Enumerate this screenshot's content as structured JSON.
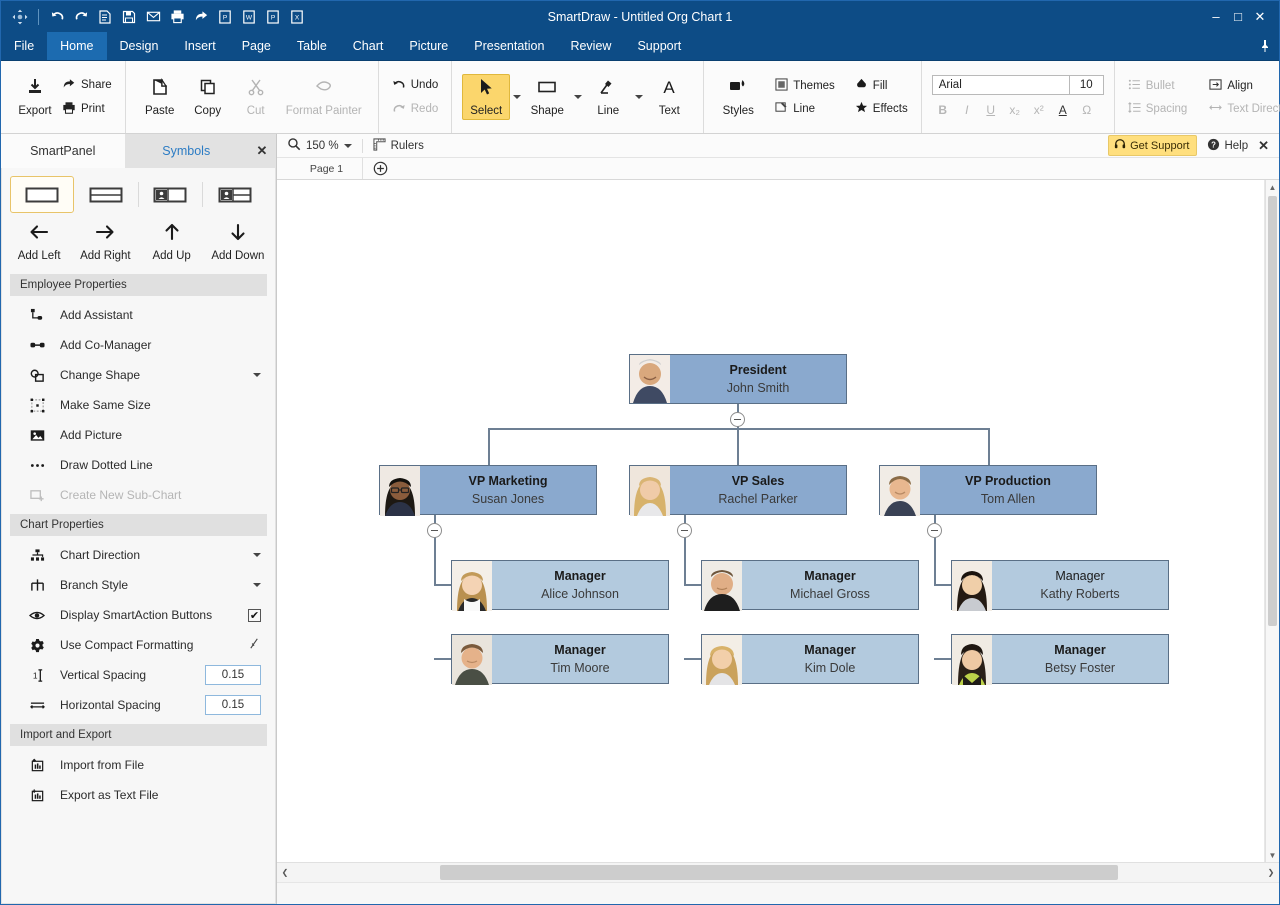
{
  "window": {
    "title": "SmartDraw - Untitled Org Chart 1",
    "minimize": "–",
    "maximize": "□",
    "close": "✕"
  },
  "quick_access": [
    {
      "name": "smartdraw-logo-icon",
      "label": "SmartDraw"
    },
    {
      "name": "undo-icon",
      "label": "Undo"
    },
    {
      "name": "redo-icon",
      "label": "Redo"
    },
    {
      "name": "new-document-icon",
      "label": "New"
    },
    {
      "name": "save-icon",
      "label": "Save"
    },
    {
      "name": "email-icon",
      "label": "Email"
    },
    {
      "name": "print-icon",
      "label": "Print"
    },
    {
      "name": "share-icon",
      "label": "Share"
    },
    {
      "name": "export-pdf-icon",
      "label": "PDF"
    },
    {
      "name": "export-word-icon",
      "label": "Word"
    },
    {
      "name": "export-powerpoint-icon",
      "label": "PowerPoint"
    },
    {
      "name": "export-excel-icon",
      "label": "Excel"
    }
  ],
  "menu": {
    "items": [
      {
        "label": "File",
        "active": false
      },
      {
        "label": "Home",
        "active": true
      },
      {
        "label": "Design",
        "active": false
      },
      {
        "label": "Insert",
        "active": false
      },
      {
        "label": "Page",
        "active": false
      },
      {
        "label": "Table",
        "active": false
      },
      {
        "label": "Chart",
        "active": false
      },
      {
        "label": "Picture",
        "active": false
      },
      {
        "label": "Presentation",
        "active": false
      },
      {
        "label": "Review",
        "active": false
      },
      {
        "label": "Support",
        "active": false
      }
    ],
    "pin_icon": "pin-icon"
  },
  "ribbon": {
    "export": "Export",
    "share": "Share",
    "print": "Print",
    "paste": "Paste",
    "copy": "Copy",
    "cut": "Cut",
    "format_painter": "Format Painter",
    "undo": "Undo",
    "redo": "Redo",
    "select": "Select",
    "shape": "Shape",
    "line": "Line",
    "text": "Text",
    "styles": "Styles",
    "themes": "Themes",
    "line_style": "Line",
    "fill": "Fill",
    "effects": "Effects",
    "font_name": "Arial",
    "font_size": "10",
    "bold": "B",
    "italic": "I",
    "underline": "U",
    "subscript": "x₂",
    "superscript": "x²",
    "font_color": "A",
    "symbol": "Ω",
    "bullet": "Bullet",
    "spacing": "Spacing",
    "align": "Align",
    "text_direction": "Text Direction"
  },
  "sidebar": {
    "tabs": [
      {
        "label": "SmartPanel",
        "active": true
      },
      {
        "label": "Symbols",
        "active": false
      }
    ],
    "close": "✕",
    "templates": [
      {
        "name": "shape-single-line-template",
        "active": true
      },
      {
        "name": "shape-two-line-template",
        "active": false
      },
      {
        "name": "shape-photo-left-template",
        "active": false
      },
      {
        "name": "shape-photo-detail-template",
        "active": false
      }
    ],
    "add_buttons": [
      {
        "label": "Add Left",
        "icon": "arrow-left-icon"
      },
      {
        "label": "Add Right",
        "icon": "arrow-right-icon"
      },
      {
        "label": "Add Up",
        "icon": "arrow-up-icon"
      },
      {
        "label": "Add Down",
        "icon": "arrow-down-icon"
      }
    ],
    "employee_section": "Employee Properties",
    "employee_items": [
      {
        "label": "Add Assistant",
        "icon": "add-assistant-icon",
        "disabled": false,
        "control": "none"
      },
      {
        "label": "Add Co-Manager",
        "icon": "add-comanager-icon",
        "disabled": false,
        "control": "none"
      },
      {
        "label": "Change Shape",
        "icon": "change-shape-icon",
        "disabled": false,
        "control": "caret"
      },
      {
        "label": "Make Same Size",
        "icon": "make-same-size-icon",
        "disabled": false,
        "control": "none"
      },
      {
        "label": "Add Picture",
        "icon": "add-picture-icon",
        "disabled": false,
        "control": "none"
      },
      {
        "label": "Draw Dotted Line",
        "icon": "dotted-line-icon",
        "disabled": false,
        "control": "none"
      },
      {
        "label": "Create New Sub-Chart",
        "icon": "sub-chart-icon",
        "disabled": true,
        "control": "none"
      }
    ],
    "chart_section": "Chart Properties",
    "chart_items": [
      {
        "label": "Chart Direction",
        "icon": "chart-direction-icon",
        "disabled": false,
        "control": "caret",
        "value": ""
      },
      {
        "label": "Branch Style",
        "icon": "branch-style-icon",
        "disabled": false,
        "control": "caret",
        "value": ""
      },
      {
        "label": "Display SmartAction Buttons",
        "icon": "eye-icon",
        "disabled": false,
        "control": "checkbox",
        "value": "✔"
      },
      {
        "label": "Use Compact Formatting",
        "icon": "gear-icon",
        "disabled": false,
        "control": "slashcheck",
        "value": ""
      },
      {
        "label": "Vertical Spacing",
        "icon": "vertical-spacing-icon",
        "disabled": false,
        "control": "number",
        "value": "0.15"
      },
      {
        "label": "Horizontal Spacing",
        "icon": "horizontal-spacing-icon",
        "disabled": false,
        "control": "number",
        "value": "0.15"
      }
    ],
    "import_section": "Import and Export",
    "import_items": [
      {
        "label": "Import from File",
        "icon": "import-file-icon"
      },
      {
        "label": "Export as Text File",
        "icon": "export-file-icon"
      }
    ]
  },
  "canvas_toolbar": {
    "zoom_icon": "zoom-icon",
    "zoom_level": "150 %",
    "rulers": "Rulers",
    "rulers_icon": "ruler-icon",
    "get_support": "Get Support",
    "support_icon": "headset-icon",
    "help": "Help",
    "help_icon": "help-circle-icon",
    "close": "✕",
    "page_tab": "Page 1",
    "add_page_icon": "plus-circle-icon"
  },
  "chart_data": {
    "type": "org-chart",
    "title": "Untitled Org Chart 1",
    "nodes": [
      {
        "id": "n1",
        "title": "President",
        "name": "John Smith",
        "level": 0,
        "title_bold": true,
        "photo": "photo-john-smith"
      },
      {
        "id": "n2",
        "title": "VP Marketing",
        "name": "Susan Jones",
        "level": 1,
        "title_bold": true,
        "photo": "photo-susan-jones",
        "parent": "n1"
      },
      {
        "id": "n3",
        "title": "VP Sales",
        "name": "Rachel Parker",
        "level": 1,
        "title_bold": true,
        "photo": "photo-rachel-parker",
        "parent": "n1"
      },
      {
        "id": "n4",
        "title": "VP Production",
        "name": "Tom Allen",
        "level": 1,
        "title_bold": true,
        "photo": "photo-tom-allen",
        "parent": "n1"
      },
      {
        "id": "n5",
        "title": "Manager",
        "name": "Alice Johnson",
        "level": 2,
        "title_bold": true,
        "photo": "photo-alice-johnson",
        "parent": "n2"
      },
      {
        "id": "n6",
        "title": "Manager",
        "name": "Tim Moore",
        "level": 2,
        "title_bold": true,
        "photo": "photo-tim-moore",
        "parent": "n2"
      },
      {
        "id": "n7",
        "title": "Manager",
        "name": "Michael Gross",
        "level": 2,
        "title_bold": true,
        "photo": "photo-michael-gross",
        "parent": "n3"
      },
      {
        "id": "n8",
        "title": "Manager",
        "name": "Kim Dole",
        "level": 2,
        "title_bold": true,
        "photo": "photo-kim-dole",
        "parent": "n3"
      },
      {
        "id": "n9",
        "title": "Manager",
        "name": "Kathy Roberts",
        "level": 2,
        "title_bold": false,
        "photo": "photo-kathy-roberts",
        "parent": "n4"
      },
      {
        "id": "n10",
        "title": "Manager",
        "name": "Betsy Foster",
        "level": 2,
        "title_bold": true,
        "photo": "photo-betsy-foster",
        "parent": "n4"
      }
    ],
    "colors": {
      "level0_fill": "#8aa9ce",
      "level1_fill": "#8aa9ce",
      "level2_fill": "#b3cade",
      "border": "#5a6f86",
      "connector": "#6d7f93"
    }
  }
}
